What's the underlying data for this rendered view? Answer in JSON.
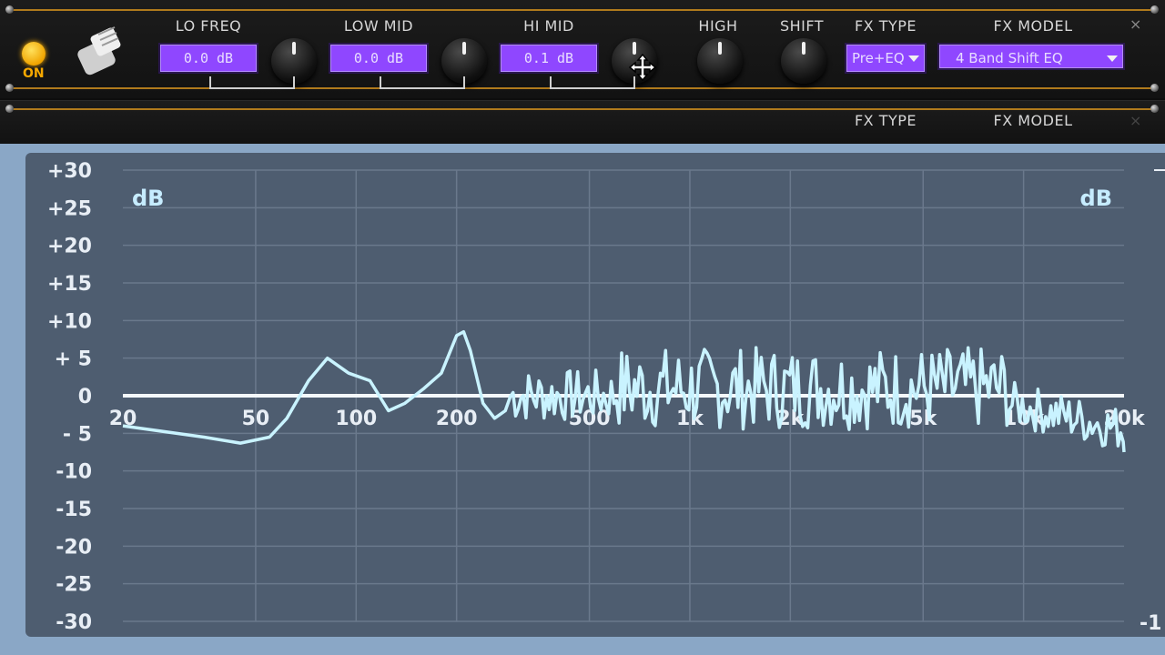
{
  "controls": {
    "power_label": "ON",
    "lo_freq": {
      "label": "LO FREQ",
      "value": "0.0 dB"
    },
    "low_mid": {
      "label": "LOW MID",
      "value": "0.0 dB"
    },
    "hi_mid": {
      "label": "HI MID",
      "value": "0.1 dB"
    },
    "high": {
      "label": "HIGH"
    },
    "shift": {
      "label": "SHIFT"
    },
    "fx_type": {
      "label": "FX TYPE",
      "value": "Pre+EQ"
    },
    "fx_model": {
      "label": "FX MODEL",
      "value": "4 Band Shift EQ"
    },
    "close_glyph": "×"
  },
  "second_slot": {
    "fx_type_label": "FX TYPE",
    "fx_model_label": "FX MODEL",
    "close_glyph": "×"
  },
  "graph": {
    "unit_left": "dB",
    "unit_right": "dB",
    "right_edge_label": "-1",
    "y_ticks": [
      "+30",
      "+25",
      "+20",
      "+15",
      "+10",
      "+ 5",
      "0",
      "- 5",
      "-10",
      "-15",
      "-20",
      "-25",
      "-30"
    ],
    "x_ticks": [
      "20",
      "50",
      "100",
      "200",
      "500",
      "1k",
      "2k",
      "5k",
      "10k",
      "20k"
    ]
  },
  "colors": {
    "accent_purple": "#8f47ff",
    "power_amber": "#f6a800",
    "graph_bg": "#4e5d70",
    "curve": "#c9f3ff"
  }
}
